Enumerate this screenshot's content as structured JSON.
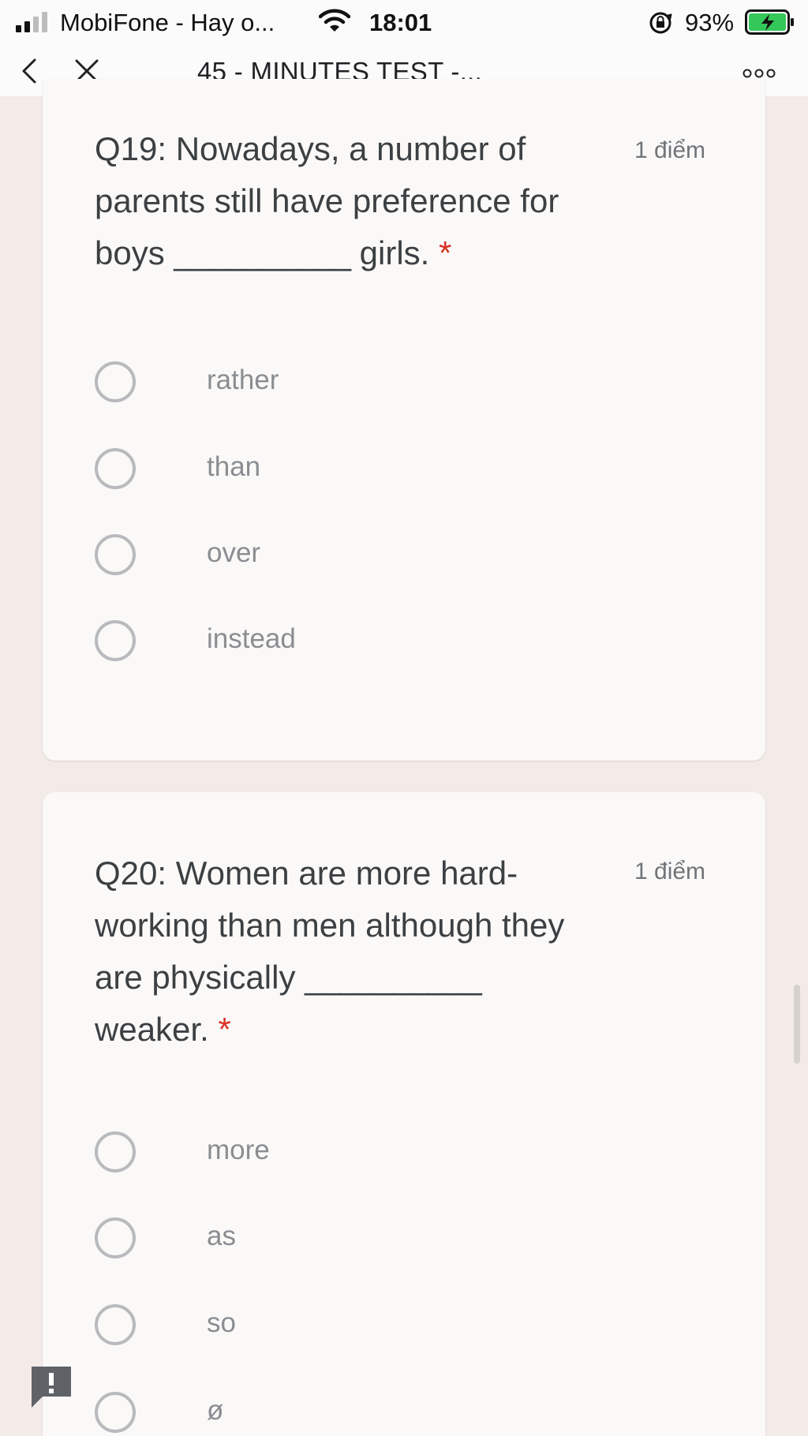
{
  "status": {
    "carrier": "MobiFone - Hay o...",
    "time": "18:01",
    "battery_pct": "93%"
  },
  "nav": {
    "title": "45 - MINUTES TEST -..."
  },
  "questions": [
    {
      "parts": [
        "Q19: Nowadays, a number of parents still have preference for boys ",
        "__________",
        " girls. "
      ],
      "required_mark": "*",
      "points": "1 điểm",
      "options": [
        "rather",
        "than",
        "over",
        "instead"
      ]
    },
    {
      "parts": [
        "Q20: Women are more hard-working than men although they are physically ",
        "__________",
        " weaker. "
      ],
      "required_mark": "*",
      "points": "1 điểm",
      "options": [
        "more",
        "as",
        "so",
        "ø"
      ]
    }
  ],
  "colors": {
    "background": "#f3ebe8",
    "card": "#faf9f8",
    "required": "#d93025",
    "battery": "#34c759"
  }
}
